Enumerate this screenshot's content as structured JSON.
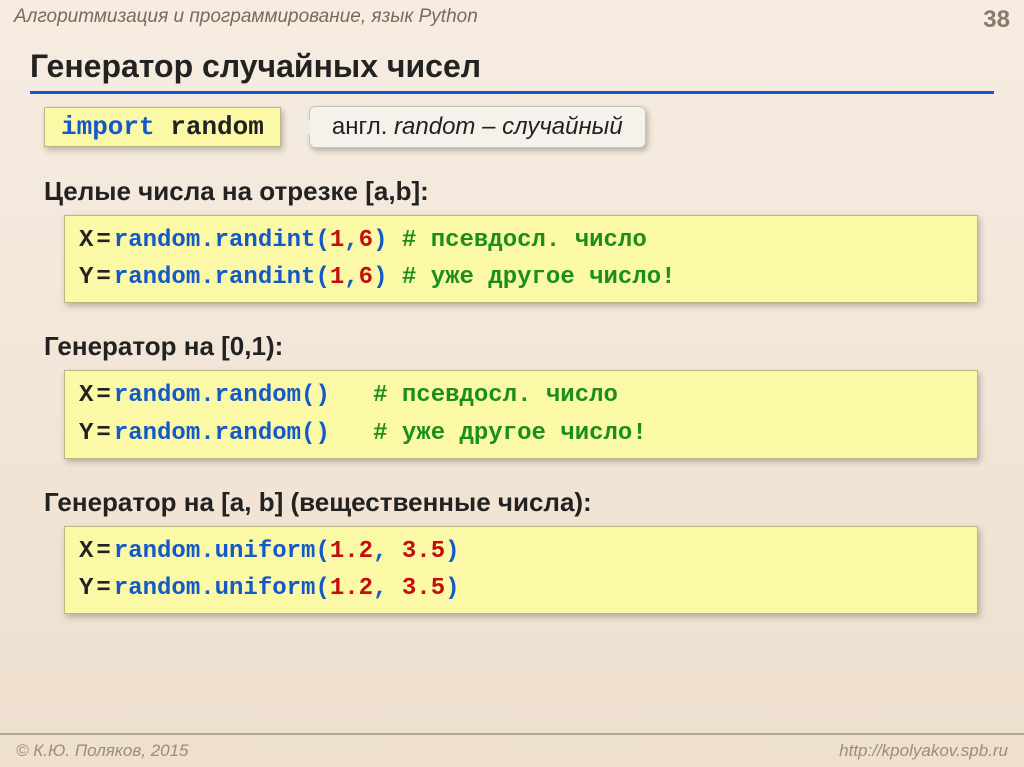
{
  "header": {
    "breadcrumb": "Алгоритмизация и программирование, язык Python",
    "page_number": "38"
  },
  "title": "Генератор случайных чисел",
  "intro": {
    "import_kw": "import",
    "import_mod": "random",
    "note_prefix": "англ. ",
    "note_word": "random",
    "note_dash": " – ",
    "note_trans": "случайный"
  },
  "sections": {
    "int_label": "Целые числа на отрезке [a,b]:",
    "int_code": {
      "l1_pre": "X",
      "l1_eq": "=",
      "l1_call": "random.randint(",
      "l1_a1": "1",
      "l1_sep": ",",
      "l1_a2": "6",
      "l1_close": ")",
      "l1_cmt": "# псевдосл. число",
      "l2_pre": "Y",
      "l2_eq": "=",
      "l2_call": "random.randint(",
      "l2_a1": "1",
      "l2_sep": ",",
      "l2_a2": "6",
      "l2_close": ")",
      "l2_cmt": "# уже другое число!"
    },
    "unit_label": "Генератор на [0,1):",
    "unit_code": {
      "l1_pre": "X",
      "l1_eq": "=",
      "l1_call": "random.random()",
      "l1_pad": "  ",
      "l1_cmt": "# псевдосл. число",
      "l2_pre": "Y",
      "l2_eq": "=",
      "l2_call": "random.random()",
      "l2_pad": "  ",
      "l2_cmt": "# уже другое число!"
    },
    "real_label": "Генератор на [a, b] (вещественные числа):",
    "real_code": {
      "l1_pre": "X",
      "l1_eq": "=",
      "l1_call": "random.uniform(",
      "l1_a1": "1.2",
      "l1_sep": ", ",
      "l1_a2": "3.5",
      "l1_close": ")",
      "l2_pre": "Y",
      "l2_eq": "=",
      "l2_call": "random.uniform(",
      "l2_a1": "1.2",
      "l2_sep": ", ",
      "l2_a2": "3.5",
      "l2_close": ")"
    }
  },
  "footer": {
    "copyright": "© К.Ю. Поляков, 2015",
    "url": "http://kpolyakov.spb.ru"
  }
}
